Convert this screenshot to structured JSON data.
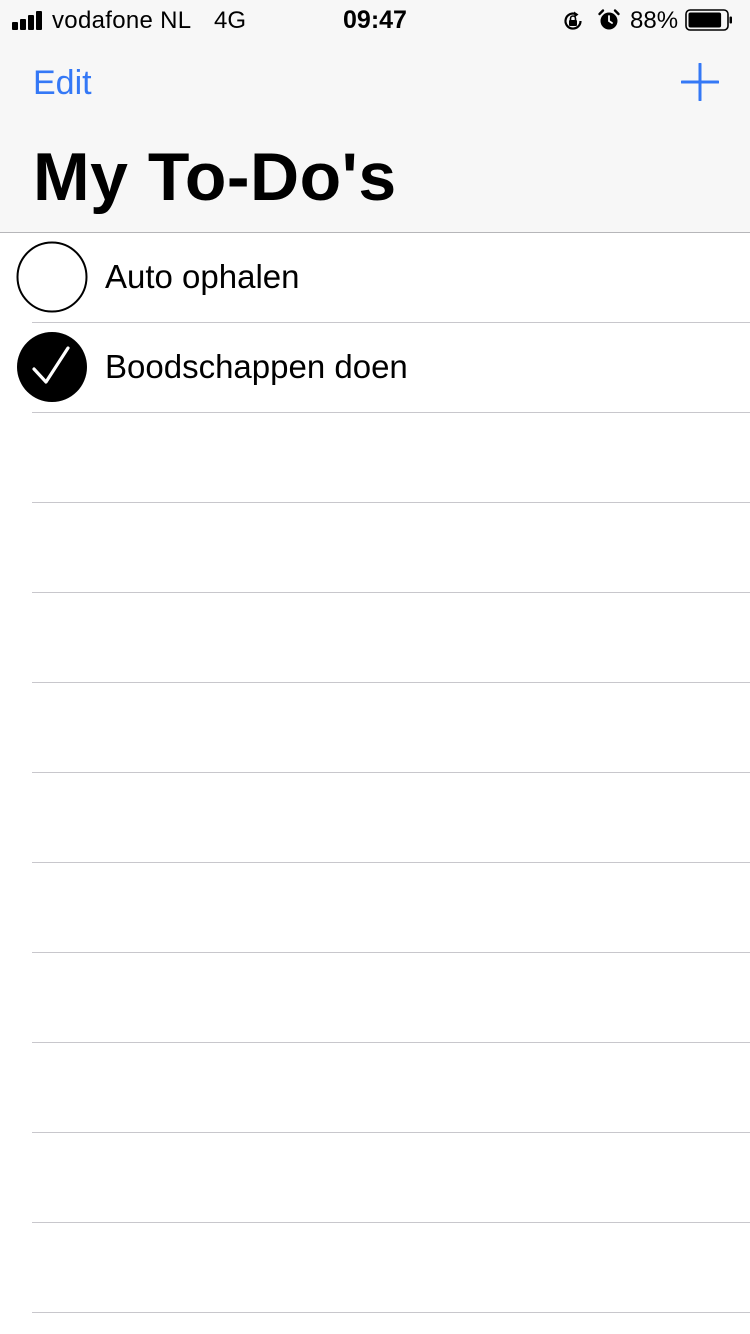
{
  "status_bar": {
    "carrier": "vodafone NL",
    "network": "4G",
    "time": "09:47",
    "battery_percent": "88%",
    "battery_level": 0.88,
    "icons": [
      "signal-icon",
      "orientation-lock-icon",
      "alarm-icon",
      "battery-icon"
    ]
  },
  "nav": {
    "edit_label": "Edit",
    "add_icon": "plus-icon",
    "title": "My To-Do's"
  },
  "todos": [
    {
      "label": "Auto ophalen",
      "done": false
    },
    {
      "label": "Boodschappen doen",
      "done": true
    }
  ],
  "colors": {
    "accent": "#3478f6",
    "bar_background": "#f7f7f7",
    "separator": "#c8c7cc"
  }
}
